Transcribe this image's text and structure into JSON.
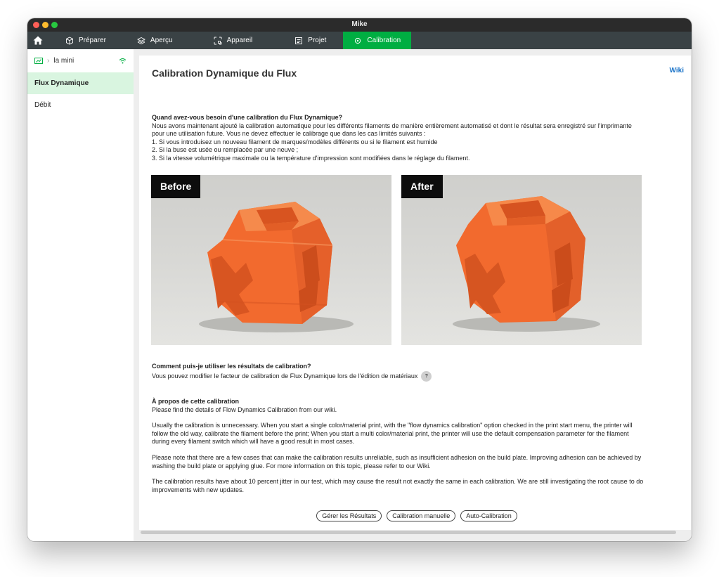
{
  "window": {
    "title": "Mike"
  },
  "tabs": [
    {
      "label": "Préparer",
      "icon": "cube-icon"
    },
    {
      "label": "Aperçu",
      "icon": "layers-icon"
    },
    {
      "label": "Appareil",
      "icon": "device-icon"
    },
    {
      "label": "Projet",
      "icon": "project-icon"
    },
    {
      "label": "Calibration",
      "icon": "calibration-icon",
      "active": true
    }
  ],
  "sidebar": {
    "device_name": "la mini",
    "items": [
      {
        "label": "Flux Dynamique",
        "active": true
      },
      {
        "label": "Débit",
        "active": false
      }
    ]
  },
  "main": {
    "title": "Calibration Dynamique du Flux",
    "wiki_link": "Wiki",
    "when": {
      "heading": "Quand avez-vous besoin d'une calibration du Flux Dynamique?",
      "intro": "Nous avons maintenant ajouté la calibration automatique pour les différents filaments de manière entièrement automatisé et dont le résultat sera enregistré sur l'imprimante pour une utilisation future. Vous ne devez effectuer le calibrage que dans les cas limités suivants :",
      "item1": "1. Si vous introduisez un nouveau filament de marques/modèles différents ou si le filament est humide",
      "item2": "2. Si la buse est usée ou remplacée par une neuve ;",
      "item3": "3. Si la vitesse volumétrique maximale ou la température d'impression sont modifiées dans le réglage du filament."
    },
    "images": {
      "before_label": "Before",
      "after_label": "After"
    },
    "how": {
      "heading": "Comment puis-je utiliser les résultats de calibration?",
      "text": "Vous pouvez modifier le facteur de calibration de Flux Dynamique lors de l'édition de matériaux",
      "help_icon_label": "?"
    },
    "about": {
      "heading": "À propos de cette calibration",
      "line1": "Please find the details of Flow Dynamics Calibration from our wiki.",
      "para1": "Usually the calibration is unnecessary. When you start a single color/material print, with the \"flow dynamics calibration\" option checked in the print start menu, the printer will follow the old way, calibrate the filament before the print; When you start a multi color/material print, the printer will use the default compensation parameter for the filament during every filament switch which will have a good result in most cases.",
      "para2": "Please note that there are a few cases that can make the calibration results unreliable, such as insufficient adhesion on the build plate. Improving adhesion can be achieved by washing the build plate or applying glue. For more information on this topic, please refer to our Wiki.",
      "para3": "The calibration results have about 10 percent jitter in our test, which may cause the result not exactly the same in each calibration. We are still investigating the root cause to do improvements with new updates."
    },
    "buttons": {
      "manage": "Gérer les Résultats",
      "manual": "Calibration manuelle",
      "auto": "Auto-Calibration"
    }
  },
  "colors": {
    "accent": "#00ae42",
    "tabbar": "#3a4245",
    "sidebar_active": "#d9f5e0",
    "wiki_link": "#1a73c8",
    "cube_orange": "#f26a2e"
  }
}
